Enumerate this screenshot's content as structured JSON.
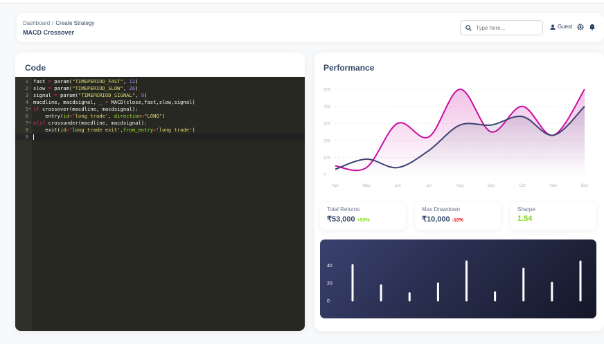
{
  "header": {
    "breadcrumb_root": "Dashboard",
    "breadcrumb_sep": "/",
    "breadcrumb_current": "Create Strategy",
    "page_title": "MACD Crossover",
    "search_placeholder": "Type here...",
    "user_label": "Guest"
  },
  "code_card": {
    "title": "Code",
    "lines": [
      "fast = param(\"TIMEPERIOD_FAST\", 12)",
      "slow = param(\"TIMEPERIOD_SLOW\", 26)",
      "signal = param(\"TIMEPERIOD_SIGNAL\", 9)",
      "macdline, macdsignal, _ = MACD(close,fast,slow,signal)",
      "if crossover(macdline, macdsignal):",
      "    entry(id='long trade', direction=\"LONG\")",
      "elif crossunder(macdline, macdsignal):",
      "    exit(id='long trade exit',from_entry='long trade')",
      ""
    ],
    "line_numbers": [
      "1",
      "2",
      "3",
      "4",
      "5",
      "6",
      "7",
      "8",
      "9"
    ]
  },
  "performance_card": {
    "title": "Performance",
    "chart_data": {
      "type": "line",
      "categories": [
        "Apr",
        "May",
        "Jun",
        "Jul",
        "Aug",
        "Sep",
        "Oct",
        "Nov",
        "Dec"
      ],
      "y_ticks": [
        "0",
        "100",
        "200",
        "300",
        "400",
        "500"
      ],
      "ylim": [
        0,
        500
      ],
      "grid": true,
      "series": [
        {
          "values": [
            50,
            40,
            300,
            220,
            500,
            250,
            400,
            230,
            500
          ],
          "color": "#cb0c9f"
        },
        {
          "values": [
            30,
            90,
            40,
            140,
            290,
            290,
            340,
            230,
            400
          ],
          "color": "#3a416f"
        }
      ]
    }
  },
  "stats": [
    {
      "label": "Total Returns",
      "value": "₹53,000",
      "change": "+53%",
      "change_color": "#82d616"
    },
    {
      "label": "Max Drawdown",
      "value": "₹10,000",
      "change": "-10%",
      "change_color": "#ea0606"
    },
    {
      "label": "Sharpe",
      "value": "1.54",
      "change": "",
      "value_color": "#82d616"
    }
  ],
  "bar_chart": {
    "chart_data": {
      "type": "bar",
      "y_ticks": [
        "0",
        "20",
        "40"
      ],
      "ylim": [
        0,
        40
      ],
      "values": [
        40,
        17,
        8,
        19,
        44,
        9,
        36,
        20,
        44
      ],
      "bar_color": "#ffffff"
    }
  },
  "icons": {
    "search": "search-icon",
    "user": "user-icon",
    "settings": "gear-icon",
    "notifications": "bell-icon"
  }
}
